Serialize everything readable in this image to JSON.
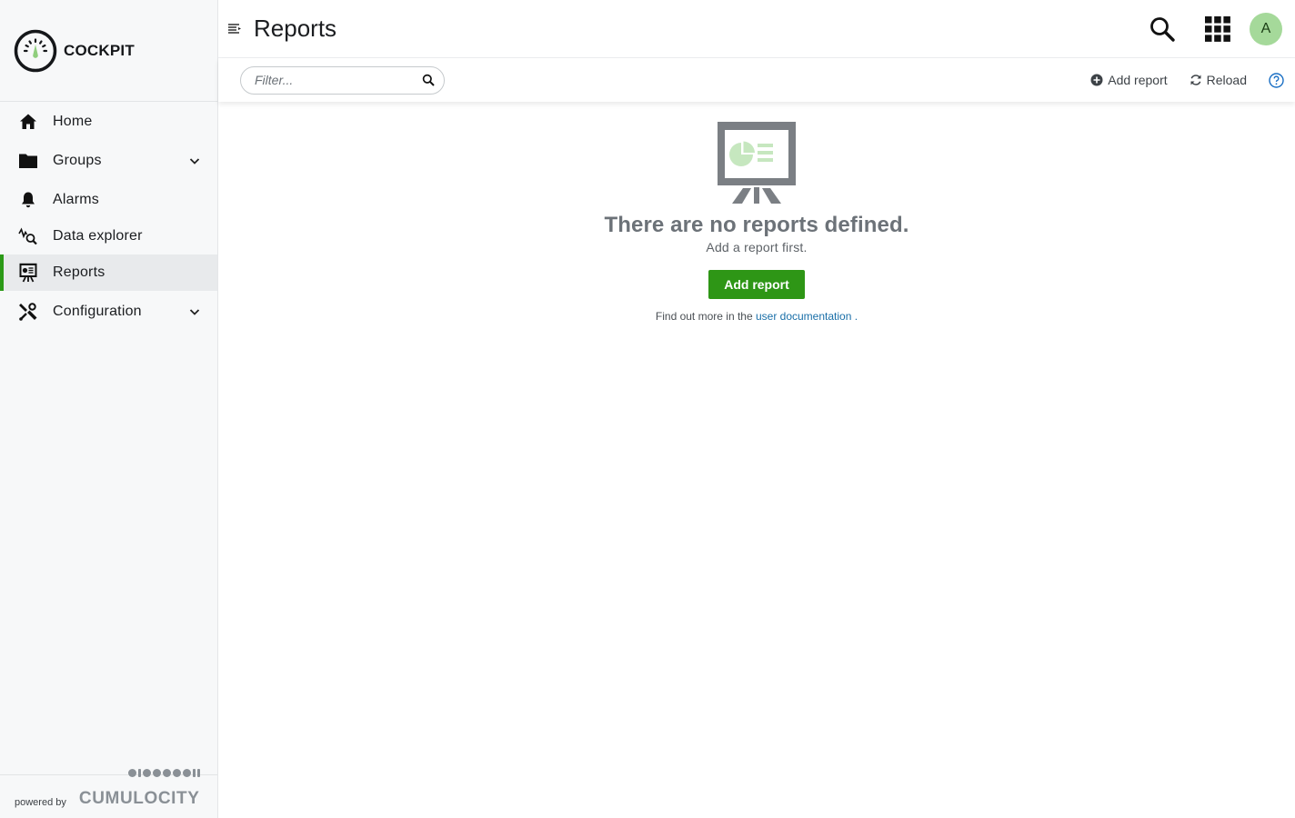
{
  "app": {
    "name": "COCKPIT"
  },
  "sidebar": {
    "items": [
      {
        "label": "Home",
        "icon": "home-icon"
      },
      {
        "label": "Groups",
        "icon": "folder-icon",
        "expandable": true
      },
      {
        "label": "Alarms",
        "icon": "bell-icon"
      },
      {
        "label": "Data explorer",
        "icon": "data-explorer-icon"
      },
      {
        "label": "Reports",
        "icon": "reports-icon",
        "active": true
      },
      {
        "label": "Configuration",
        "icon": "configuration-icon",
        "expandable": true
      }
    ],
    "footer": {
      "powered_by": "powered by",
      "brand": "CUMULOCITY"
    }
  },
  "header": {
    "title": "Reports",
    "avatar_initial": "A"
  },
  "toolbar": {
    "filter_placeholder": "Filter...",
    "add_report": "Add report",
    "reload": "Reload"
  },
  "empty_state": {
    "title": "There are no reports defined.",
    "subtitle": "Add a report first.",
    "button": "Add report",
    "doc_prefix": "Find out more in the",
    "doc_link": "user documentation",
    "doc_suffix": "."
  },
  "colors": {
    "accent": "#2e9616",
    "link": "#1a6fa8",
    "avatar": "#a5d99a",
    "icon_gray": "#7b7f84",
    "icon_green": "#c6e7bf"
  }
}
